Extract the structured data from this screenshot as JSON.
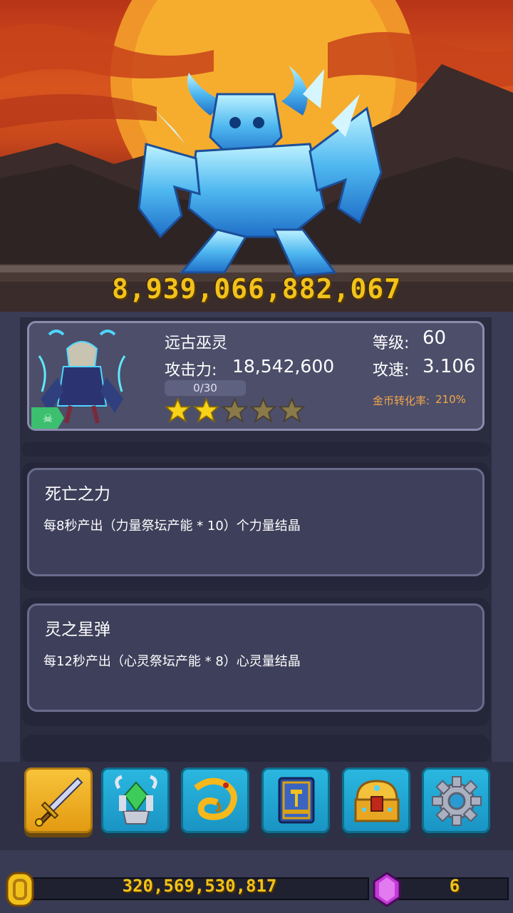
{
  "scene": {
    "boss_hp": "8,939,066,882,067",
    "boss_icon": "ice-demon-icon"
  },
  "hero": {
    "name": "远古巫灵",
    "attack_label": "攻击力:",
    "attack_value": "18,542,600",
    "level_label": "等级:",
    "level_value": "60",
    "speed_label": "攻速:",
    "speed_value": "3.106",
    "gold_rate_label": "金币转化率:",
    "gold_rate_value": "210%",
    "progress_text": "0/30",
    "progress_fraction": 0,
    "stars_filled": 2,
    "stars_total": 5,
    "portrait_icon": "undead-lich-icon",
    "badge_icon": "skull-badge-icon"
  },
  "skills": [
    {
      "title": "死亡之力",
      "desc": "每8秒产出（力量祭坛产能 * 10）个力量结晶"
    },
    {
      "title": "灵之星弹",
      "desc": "每12秒产出（心灵祭坛产能 * 8）心灵量结晶"
    }
  ],
  "menu": {
    "items": [
      {
        "icon": "sword-icon",
        "active": true
      },
      {
        "icon": "crystal-altar-icon",
        "active": false
      },
      {
        "icon": "golden-dragon-icon",
        "active": false
      },
      {
        "icon": "spellbook-icon",
        "active": false
      },
      {
        "icon": "treasure-chest-icon",
        "active": false
      },
      {
        "icon": "settings-gear-icon",
        "active": false
      }
    ]
  },
  "resources": {
    "gold": "320,569,530,817",
    "gems": "6",
    "gold_icon": "gold-coin-icon",
    "gem_icon": "purple-gem-icon"
  },
  "colors": {
    "accent_gold": "#f1c21b",
    "menu_active": "#f7c33a",
    "menu_inactive": "#2ab7e0",
    "gold_rate": "#f3a64a"
  }
}
